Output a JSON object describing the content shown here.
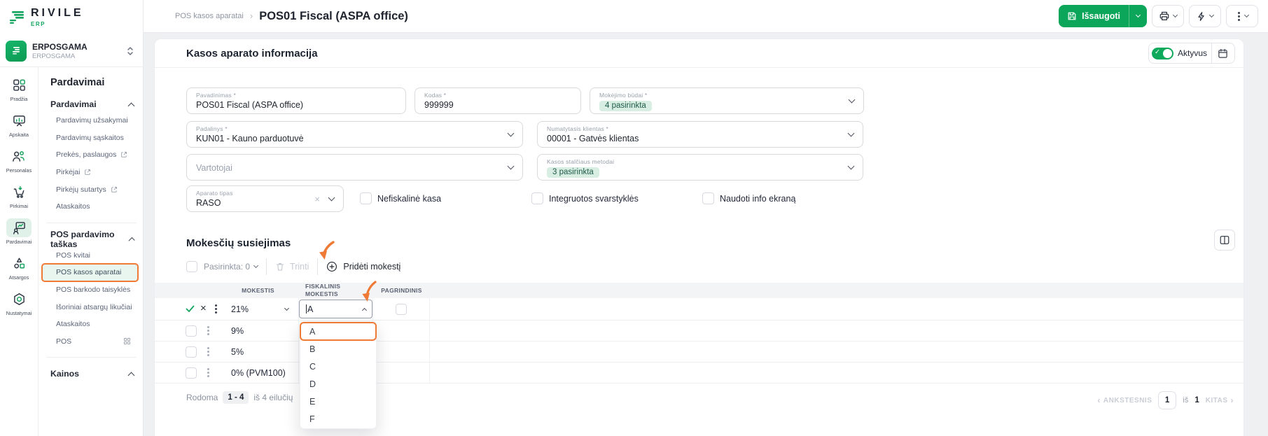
{
  "colors": {
    "accent_green": "#0ca65a",
    "annotation_orange": "#ee7a35",
    "chip_bg": "#d8eee3",
    "page_bg": "#eff0f2"
  },
  "brand": {
    "name": "RIVILE",
    "product": "ERP"
  },
  "workspace": {
    "name": "ERPOSGAMA",
    "subtitle": "ERPOSGAMA"
  },
  "nav_rail": {
    "items": [
      {
        "label": "Pradžia"
      },
      {
        "label": "Apskaita"
      },
      {
        "label": "Personalas"
      },
      {
        "label": "Pirkimai"
      },
      {
        "label": "Pardavimai"
      },
      {
        "label": "Atsargos"
      },
      {
        "label": "Nustatymai"
      }
    ]
  },
  "sidebar": {
    "title": "Pardavimai",
    "group1": {
      "label": "Pardavimai",
      "items": [
        "Pardavimų užsakymai",
        "Pardavimų sąskaitos",
        "Prekės, paslaugos",
        "Pirkėjai",
        "Pirkėjų sutartys",
        "Ataskaitos"
      ]
    },
    "group2": {
      "label": "POS pardavimo taškas",
      "items": [
        "POS kvitai",
        "POS kasos aparatai",
        "POS barkodo taisyklės",
        "Išoriniai atsargų likučiai",
        "Ataskaitos",
        "POS"
      ]
    },
    "group3": {
      "label": "Kainos"
    }
  },
  "topbar": {
    "breadcrumb": "POS kasos aparatai",
    "title": "POS01 Fiscal (ASPA office)",
    "save_label": "Išsaugoti"
  },
  "info": {
    "title": "Kasos aparato informacija",
    "active_label": "Aktyvus",
    "required_mark": "*",
    "fields": {
      "pavadinimas": {
        "label": "Pavadinimas",
        "value": "POS01 Fiscal (ASPA office)"
      },
      "kodas": {
        "label": "Kodas",
        "value": "999999"
      },
      "mokejimo_budai": {
        "label": "Mokėjimo būdai",
        "chip": "4 pasirinkta"
      },
      "padalinys": {
        "label": "Padalinys",
        "value": "KUN01 - Kauno parduotuvė"
      },
      "numatytasis_klientas": {
        "label": "Numatytasis klientas",
        "value": "00001 - Gatvės klientas"
      },
      "vartotojai": {
        "placeholder": "Vartotojai"
      },
      "kasos_stalciaus": {
        "label": "Kasos stalčiaus metodai",
        "chip": "3 pasirinkta"
      },
      "aparato_tipas": {
        "label": "Aparato tipas",
        "value": "RASO"
      }
    },
    "checkboxes": [
      "Nefiskalinė kasa",
      "Integruotos svarstyklės",
      "Naudoti info ekraną"
    ]
  },
  "taxes": {
    "title": "Mokesčių susiejimas",
    "selected_label": "Pasirinkta: 0",
    "delete_label": "Trinti",
    "add_label": "Pridėti mokestį",
    "columns": {
      "mokestis": "MOKESTIS",
      "fiskalinis": "FISKALINIS MOKESTIS",
      "pagrindinis": "PAGRINDINIS"
    },
    "edit_row": {
      "mokestis": "21%",
      "fiskalinis_input": "A"
    },
    "rows": [
      "9%",
      "5%",
      "0% (PVM100)"
    ],
    "dropdown_options": [
      "A",
      "B",
      "C",
      "D",
      "E",
      "F"
    ],
    "footer": {
      "showing": "Rodoma",
      "range": "1 - 4",
      "of_total": "iš 4 eilučių"
    },
    "pagination": {
      "prev": "ANKSTESNIS",
      "page": "1",
      "of": "iš",
      "pages": "1",
      "next": "KITAS"
    }
  }
}
